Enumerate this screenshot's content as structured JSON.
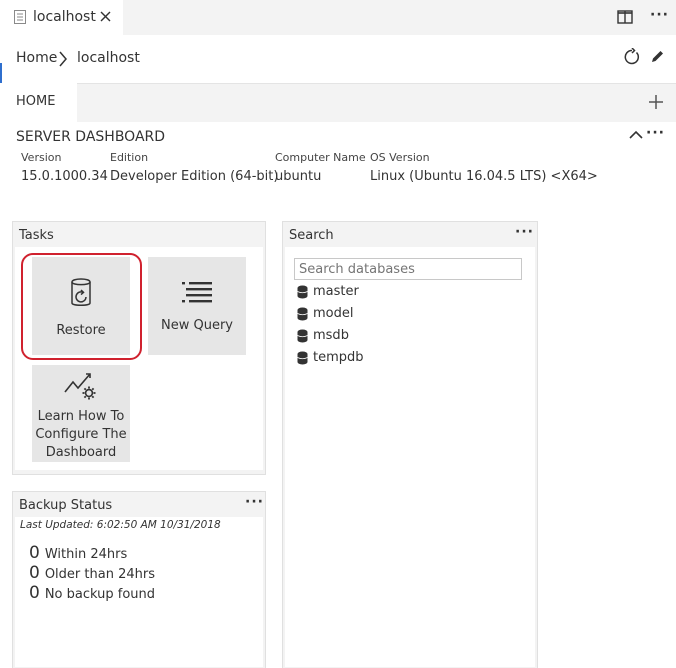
{
  "tab": {
    "title": "localhost"
  },
  "breadcrumb": {
    "home": "Home",
    "current": "localhost"
  },
  "home_tab": {
    "label": "HOME"
  },
  "dashboard": {
    "title": "SERVER DASHBOARD",
    "properties": [
      {
        "label": "Version",
        "value": "15.0.1000.34"
      },
      {
        "label": "Edition",
        "value": "Developer Edition (64-bit)"
      },
      {
        "label": "Computer Name",
        "value": "ubuntu"
      },
      {
        "label": "OS Version",
        "value": "Linux (Ubuntu 16.04.5 LTS) <X64>"
      }
    ]
  },
  "tasks": {
    "title": "Tasks",
    "items": [
      {
        "label": "Restore"
      },
      {
        "label": "New Query"
      },
      {
        "label_lines": [
          "Learn How To",
          "Configure The",
          "Dashboard"
        ]
      }
    ],
    "highlight_color": "#d0212e"
  },
  "search": {
    "title": "Search",
    "placeholder": "Search databases",
    "databases": [
      "master",
      "model",
      "msdb",
      "tempdb"
    ]
  },
  "backup": {
    "title": "Backup Status",
    "last_updated": "Last Updated: 6:02:50 AM 10/31/2018",
    "rows": [
      {
        "count": "0",
        "label": "Within 24hrs"
      },
      {
        "count": "0",
        "label": "Older than 24hrs"
      },
      {
        "count": "0",
        "label": "No backup found"
      }
    ]
  },
  "more_label": "···"
}
